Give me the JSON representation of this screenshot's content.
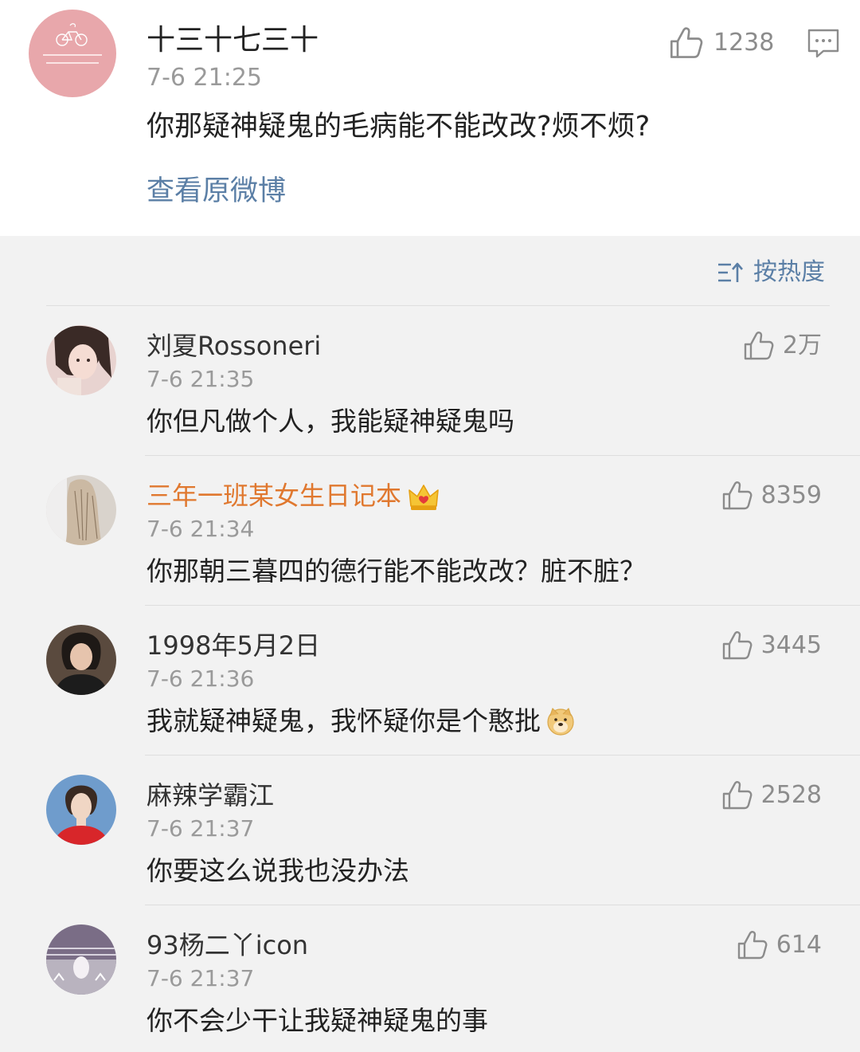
{
  "post": {
    "author": "十三十七三十",
    "time": "7-6 21:25",
    "text": "你那疑神疑鬼的毛病能不能改改?烦不烦?",
    "view_original": "查看原微博",
    "likes": "1238"
  },
  "sort": {
    "label": "按热度"
  },
  "comments": [
    {
      "name": "刘夏Rossoneri",
      "time": "7-6 21:35",
      "text": "你但凡做个人，我能疑神疑鬼吗",
      "likes": "2万"
    },
    {
      "name": "三年一班某女生日记本",
      "time": "7-6 21:34",
      "text": "你那朝三暮四的德行能不能改改？脏不脏？",
      "likes": "8359",
      "badge": "crown-icon"
    },
    {
      "name": "1998年5月2日",
      "time": "7-6 21:36",
      "text": "我就疑神疑鬼，我怀疑你是个憨批",
      "likes": "3445",
      "emoji": "doge-emoji"
    },
    {
      "name": "麻辣学霸江",
      "time": "7-6 21:37",
      "text": "你要这么说我也没办法",
      "likes": "2528"
    },
    {
      "name": "93杨二丫icon",
      "time": "7-6 21:37",
      "text": "你不会少干让我疑神疑鬼的事",
      "likes": "614"
    }
  ],
  "colors": {
    "link": "#5b7fa6",
    "vip_name": "#e0782f",
    "meta_gray": "#9a9a9a",
    "background": "#f2f2f2"
  }
}
